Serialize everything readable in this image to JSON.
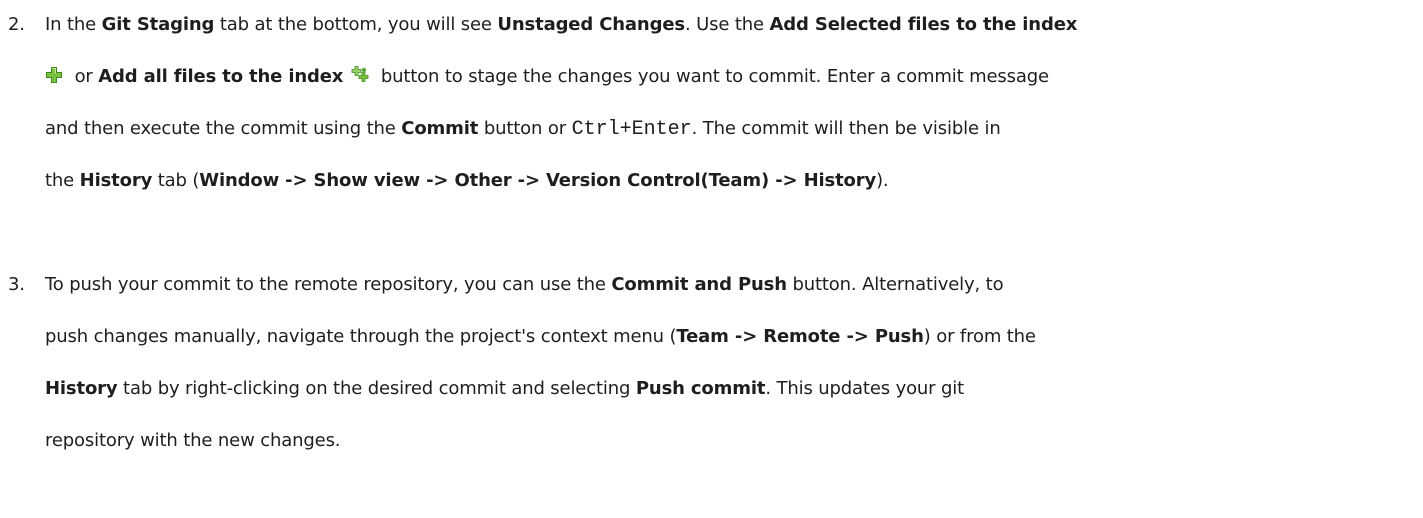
{
  "steps": [
    {
      "number": "2.",
      "lines": [
        {
          "t1": "In the ",
          "b1": "Git Staging",
          "t2": " tab at the bottom, you will see ",
          "b2": "Unstaged Changes",
          "t3": ". Use the ",
          "b3": "Add Selected files to the index"
        },
        {
          "icon1": "green-plus-icon",
          "t1": " or ",
          "b1": "Add all files to the index",
          "icon2": "green-plus-multiple-icon",
          "t2": " button to stage the changes you want to commit. Enter a commit message"
        },
        {
          "t1": "and then execute the commit using the ",
          "b1": "Commit",
          "t2": " button or ",
          "code1": "Ctrl+Enter",
          "t3": ". The commit will then be visible in"
        },
        {
          "t1": "the ",
          "b1": "History",
          "t2": " tab (",
          "b2": "Window -> Show view -> Other -> Version Control(Team) -> History",
          "t3": ")."
        }
      ]
    },
    {
      "number": "3.",
      "lines": [
        {
          "t1": "To push your commit to the remote repository, you can use the ",
          "b1": "Commit and Push",
          "t2": " button. Alternatively, to"
        },
        {
          "t1": "push changes manually, navigate through the project's context menu (",
          "b1": "Team -> Remote -> Push",
          "t2": ") or from the"
        },
        {
          "b1": "History",
          "t1": " tab by right-clicking on the desired commit and selecting ",
          "b2": "Push commit",
          "t2": ". This updates your git"
        },
        {
          "t1": "repository with the new changes."
        }
      ]
    }
  ],
  "colors": {
    "text": "#1e1e1e",
    "icon_green": "#7cc242",
    "icon_green_dark": "#3f8a1f"
  }
}
